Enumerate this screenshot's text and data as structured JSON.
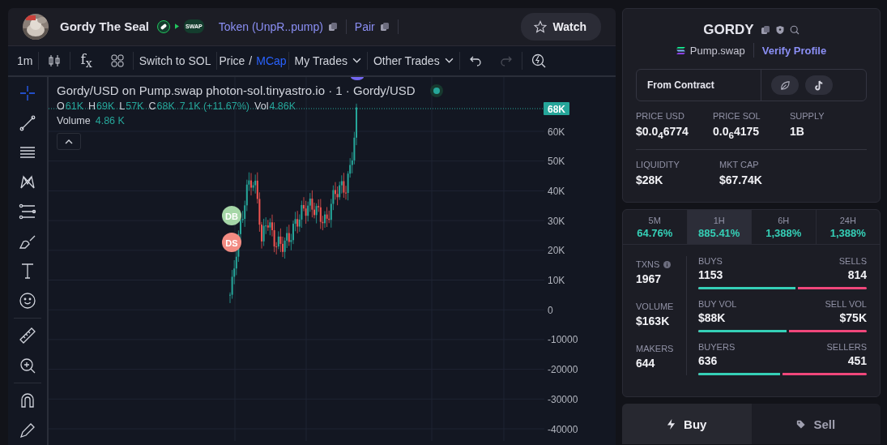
{
  "header": {
    "title": "Gordy The Seal",
    "swap_badge": "SWAP",
    "token_link": "Token (UnpR..pump)",
    "pair_link": "Pair",
    "watch_button": "Watch"
  },
  "toolbar": {
    "interval": "1m",
    "indicators": "f$_{x}$",
    "switch": "Switch to SOL",
    "price_toggle": [
      {
        "label": "Price",
        "selected": false
      },
      {
        "label": "MCap",
        "selected": true
      }
    ],
    "separator": "/",
    "dropdowns": [
      "My Trades",
      "Other Trades"
    ],
    "history": [
      {
        "kind": "undo",
        "disabled": false
      },
      {
        "kind": "redo",
        "disabled": true
      }
    ]
  },
  "tools": [
    {
      "kind": "crosshair",
      "selected": true
    },
    {
      "kind": "trendline",
      "selected": false
    },
    {
      "kind": "hlines",
      "selected": false
    },
    {
      "kind": "pattern",
      "selected": false
    },
    {
      "kind": "fib",
      "selected": false
    },
    {
      "kind": "brush",
      "selected": false
    },
    {
      "kind": "text",
      "selected": false
    },
    {
      "kind": "emoji",
      "selected": false
    },
    {
      "kind": "ruler",
      "selected": false
    },
    {
      "kind": "zoom",
      "selected": false
    },
    {
      "kind": "magnet",
      "selected": false
    },
    {
      "kind": "pencil",
      "selected": false
    }
  ],
  "chart": {
    "title": "Gordy/USD on Pump.swap photon-sol.tinyastro.io · 1 · Gordy/USD",
    "ohlc": [
      {
        "label": "O",
        "value": "61K"
      },
      {
        "label": "H",
        "value": "69K"
      },
      {
        "label": "L",
        "value": "57K"
      },
      {
        "label": "C",
        "value": "68K"
      }
    ],
    "change": "7.1K (+11.67%)",
    "volume_label": "Vol",
    "volume_value": "4.86K",
    "volume_study": {
      "label": "Volume",
      "value": "4.86 K"
    },
    "price_badge": "68K",
    "axis_labels": [
      "60K",
      "50K",
      "40K",
      "30K",
      "20K",
      "10K",
      "0",
      "-10000",
      "-20000",
      "-30000",
      "-40000"
    ],
    "markers": [
      {
        "label": "DB",
        "color": "#a5d6a7"
      },
      {
        "label": "DS",
        "color": "#f28b82"
      }
    ]
  },
  "token": {
    "symbol": "GORDY",
    "dex": "Pump.swap",
    "verify_link": "Verify Profile",
    "source": "From Contract",
    "stats": [
      [
        {
          "label": "PRICE USD",
          "value": "$0.0$_{4}$6774"
        },
        {
          "label": "PRICE SOL",
          "value": "0.0$_{6}$4175"
        },
        {
          "label": "SUPPLY",
          "value": "1B"
        }
      ],
      [
        {
          "label": "LIQUIDITY",
          "value": "$28K"
        },
        {
          "label": "MKT CAP",
          "value": "$67.74K"
        }
      ]
    ]
  },
  "timeframes": [
    {
      "label": "5M",
      "change": "64.76%",
      "selected": false
    },
    {
      "label": "1H",
      "change": "885.41%",
      "selected": true
    },
    {
      "label": "6H",
      "change": "1,388%",
      "selected": false
    },
    {
      "label": "24H",
      "change": "1,388%",
      "selected": false
    }
  ],
  "summary": [
    {
      "label": "TXNS",
      "value": "1967",
      "info": true
    },
    {
      "label": "VOLUME",
      "value": "$163K",
      "info": false
    },
    {
      "label": "MAKERS",
      "value": "644",
      "info": false
    }
  ],
  "flows": [
    {
      "left_label": "BUYS",
      "left_value": "1153",
      "right_label": "SELLS",
      "right_value": "814",
      "level": 0.59
    },
    {
      "left_label": "BUY VOL",
      "left_value": "$88K",
      "right_label": "SELL VOL",
      "right_value": "$75K",
      "level": 0.54
    },
    {
      "left_label": "BUYERS",
      "left_value": "636",
      "right_label": "SELLERS",
      "right_value": "451",
      "level": 0.5
    }
  ],
  "trade_tabs": [
    {
      "label": "Buy",
      "kind": "buy",
      "selected": true
    },
    {
      "label": "Sell",
      "kind": "sell",
      "selected": false
    }
  ]
}
